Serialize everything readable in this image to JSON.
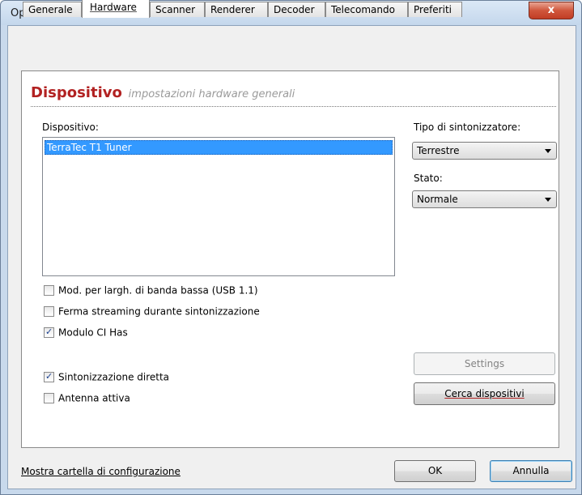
{
  "window": {
    "title": "Opzioni",
    "close_glyph": "x"
  },
  "tabs": [
    {
      "label": "Generale"
    },
    {
      "label": "Hardware",
      "active": true
    },
    {
      "label": "Scanner"
    },
    {
      "label": "Renderer"
    },
    {
      "label": "Decoder"
    },
    {
      "label": "Telecomando"
    },
    {
      "label": "Preferiti"
    }
  ],
  "heading": {
    "main": "Dispositivo",
    "sub": "impostazioni hardware generali"
  },
  "device": {
    "label": "Dispositivo:",
    "items": [
      "TerraTec T1 Tuner"
    ]
  },
  "tuner_type": {
    "label": "Tipo di sintonizzatore:",
    "value": "Terrestre"
  },
  "state": {
    "label": "Stato:",
    "value": "Normale"
  },
  "checkboxes": {
    "low_bandwidth": {
      "label": "Mod. per largh. di banda bassa (USB 1.1)",
      "checked": false
    },
    "stop_streaming": {
      "label": "Ferma streaming durante sintonizzazione",
      "checked": false
    },
    "ci_module": {
      "label": "Modulo CI Has",
      "checked": true
    },
    "direct_tuning": {
      "label": "Sintonizzazione diretta",
      "checked": true
    },
    "active_antenna": {
      "label": "Antenna attiva",
      "checked": false
    }
  },
  "buttons": {
    "settings": "Settings",
    "search_devices": "Cerca dispositivi",
    "ok": "OK",
    "cancel": "Annulla"
  },
  "footer_link": "Mostra cartella di configurazione",
  "colors": {
    "heading_red": "#b22222",
    "selection_blue": "#3399ff"
  }
}
